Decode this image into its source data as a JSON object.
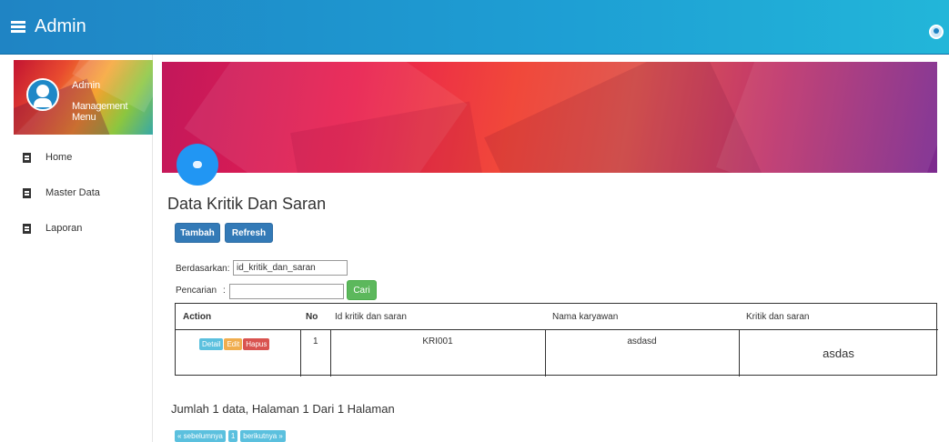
{
  "header": {
    "title": "Admin",
    "menu_icon": "menu-icon",
    "user_icon": "user-icon"
  },
  "sidebar": {
    "profile": {
      "name": "Admin",
      "role": "Management Menu"
    },
    "items": [
      {
        "label": "Home",
        "icon": "book-icon"
      },
      {
        "label": "Master Data",
        "icon": "book-icon"
      },
      {
        "label": "Laporan",
        "icon": "book-icon"
      }
    ]
  },
  "main": {
    "page_title": "Data Kritik Dan Saran",
    "buttons": {
      "add": "Tambah",
      "refresh": "Refresh"
    },
    "filter": {
      "by_label": "Berdasarkan:",
      "by_value": "id_kritik_dan_saran",
      "search_label": "Pencarian",
      "search_colon": ":",
      "search_value": "",
      "search_button": "Cari"
    },
    "table": {
      "headers": [
        "Action",
        "No",
        "Id kritik dan saran",
        "Nama karyawan",
        "Kritik dan saran"
      ],
      "rows": [
        {
          "actions": [
            "Detail",
            "Edit",
            "Hapus"
          ],
          "no": "1",
          "id": "KRI001",
          "nama": "asdasd",
          "kritik": "asdas"
        }
      ]
    },
    "summary": "Jumlah 1 data, Halaman 1 Dari 1 Halaman",
    "pagination": {
      "prev": "« sebelumnya",
      "page": "1",
      "next": "berikutnya »"
    }
  },
  "colors": {
    "header": "#1f84c4",
    "primary_button": "#337ab7",
    "success_button": "#5cb85c",
    "info_button": "#5bc0de",
    "warning_button": "#f0ad4e",
    "danger_button": "#d9534f"
  }
}
